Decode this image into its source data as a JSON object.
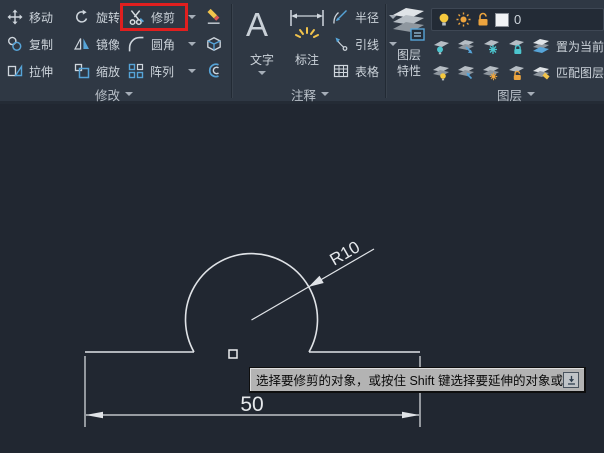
{
  "ribbon": {
    "modify": {
      "label": "修改",
      "move": "移动",
      "rotate": "旋转",
      "trim": "修剪",
      "copy": "复制",
      "mirror": "镜像",
      "fillet": "圆角",
      "stretch": "拉伸",
      "scale": "缩放",
      "array": "阵列"
    },
    "annotate": {
      "label": "注释",
      "text": "文字",
      "text_icon_glyph": "A",
      "dimension": "标注",
      "radius": "半径",
      "leader": "引线",
      "table": "表格"
    },
    "layers": {
      "label": "图层",
      "properties_line1": "图层",
      "properties_line2": "特性",
      "current_layer": "0",
      "set_current": "置为当前",
      "match_layer": "匹配图层"
    }
  },
  "canvas": {
    "width_dim": "50",
    "radius_dim": "R10",
    "tooltip_text": "选择要修剪的对象，或按住 Shift 键选择要延伸的对象或"
  },
  "icons": {
    "trim": "scissors-icon",
    "move": "four-way-arrow-icon",
    "rotate": "circular-arrow-icon",
    "erase": "eraser-pencil-icon",
    "explode": "cube-icon",
    "offset": "concentric-curves-icon",
    "layer_on": "lightbulb-icon",
    "layer_color": "white-swatch-icon",
    "tooltip_more": "down-arrow-icon"
  },
  "colors": {
    "highlight_red": "#e11f1f",
    "ribbon_bg": "#2f3844",
    "canvas_bg": "#212731",
    "drawing_line": "#e0e3e7",
    "accent_blue": "#56a4d8",
    "accent_yellow": "#f2c44c",
    "accent_orange": "#eca43e",
    "accent_cyan": "#4cc5ce",
    "tooltip_bg": "#b3b3b3"
  }
}
